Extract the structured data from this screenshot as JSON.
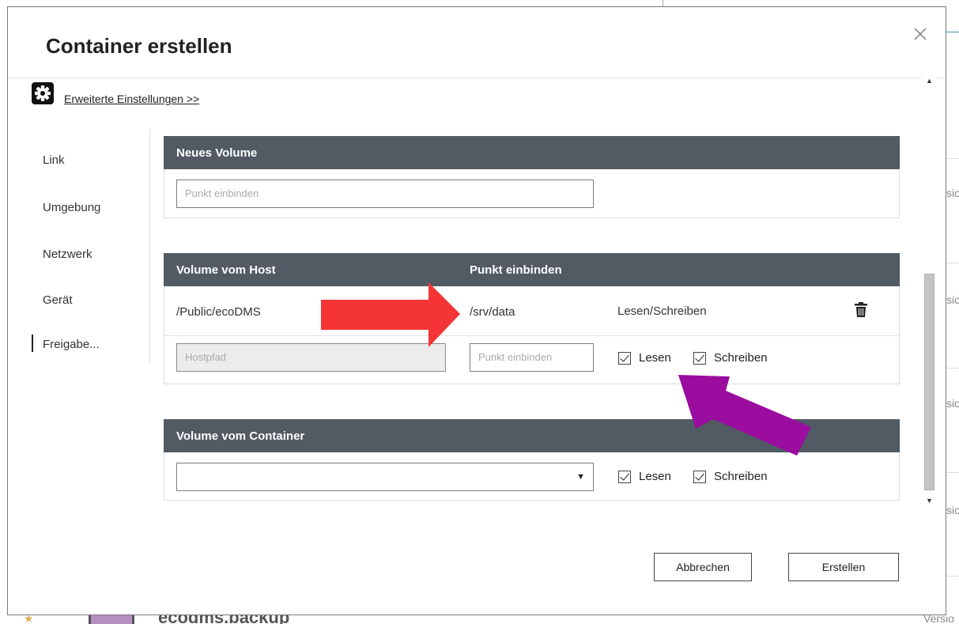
{
  "dialog": {
    "title": "Container erstellen",
    "close_icon": "close-icon",
    "advanced_link": "Erweiterte Einstellungen >>",
    "gear_icon": "gear-icon"
  },
  "nav": {
    "items": [
      {
        "label": "Link"
      },
      {
        "label": "Umgebung"
      },
      {
        "label": "Netzwerk"
      },
      {
        "label": "Gerät"
      },
      {
        "label": "Freigabe..."
      }
    ],
    "active_index": 4
  },
  "new_volume": {
    "header": "Neues Volume",
    "mount_placeholder": "Punkt einbinden"
  },
  "host_volume": {
    "col_host": "Volume vom Host",
    "col_mount": "Punkt einbinden",
    "rows": [
      {
        "host": "/Public/ecoDMS",
        "mount": "/srv/data",
        "mode": "Lesen/Schreiben"
      }
    ],
    "new_row": {
      "host_placeholder": "Hostpfad",
      "mount_placeholder": "Punkt einbinden",
      "read_label": "Lesen",
      "read_checked": true,
      "write_label": "Schreiben",
      "write_checked": true
    }
  },
  "container_volume": {
    "header": "Volume vom Container",
    "select_value": "",
    "read_label": "Lesen",
    "read_checked": true,
    "write_label": "Schreiben",
    "write_checked": true
  },
  "footer": {
    "cancel_label": "Abbrechen",
    "create_label": "Erstellen"
  },
  "background": {
    "right_fragment": "sio",
    "bottom_title_fragment": "ecodms.backup",
    "bottom_right_fragment": "Versio"
  },
  "colors": {
    "panel_header": "#525a64",
    "annotation_red": "#f53535",
    "annotation_purple": "#9a0d9e"
  }
}
